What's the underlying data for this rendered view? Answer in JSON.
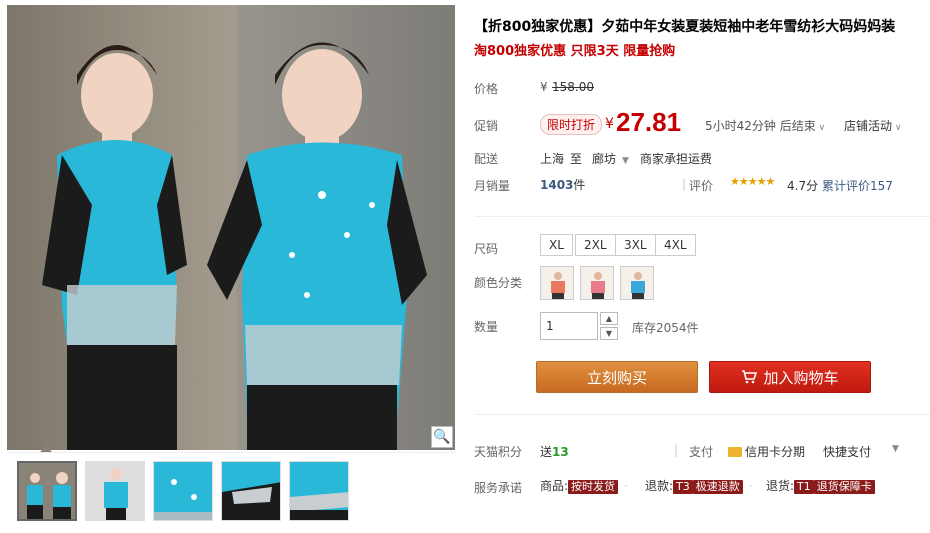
{
  "product": {
    "title": "【折800独家优惠】夕茹中年女装夏装短袖中老年雪纺衫大码妈妈装",
    "promo_line": "淘800独家优惠 只限3天 限量抢购"
  },
  "price": {
    "label": "价格",
    "currency": "¥",
    "original": "158.00",
    "promo_label": "促销",
    "badge": "限时打折",
    "current": "27.81",
    "countdown": "5小时42分钟 后结束",
    "store_activity": "店铺活动"
  },
  "shipping": {
    "label": "配送",
    "from": "上海",
    "to_word": "至",
    "to": "廊坊",
    "fee": "商家承担运费"
  },
  "sales": {
    "label": "月销量",
    "count": "1403",
    "unit": "件",
    "rating_label": "评价",
    "score": "4.7分",
    "stars": 4.7,
    "reviews_text": "累计评价157"
  },
  "size": {
    "label": "尺码",
    "options": [
      "XL",
      "2XL",
      "3XL",
      "4XL"
    ]
  },
  "color": {
    "label": "颜色分类",
    "swatches": [
      {
        "name": "coral-shirt-swatch",
        "color": "#e87860"
      },
      {
        "name": "pink-shirt-swatch",
        "color": "#e87a8a"
      },
      {
        "name": "blue-shirt-swatch",
        "color": "#3aa8d8"
      }
    ]
  },
  "quantity": {
    "label": "数量",
    "value": "1",
    "stock": "库存2054件"
  },
  "actions": {
    "buy_now": "立刻购买",
    "add_to_cart": "加入购物车"
  },
  "points": {
    "label": "天猫积分",
    "send_word": "送",
    "value": "13",
    "pay_label": "支付",
    "credit_card": "信用卡分期",
    "quick_pay": "快捷支付"
  },
  "service": {
    "label": "服务承诺",
    "goods_label": "商品:",
    "goods_tag": "按时发货",
    "refund_label": "退款:",
    "refund_code": "T3",
    "refund_tag": "极速退款",
    "return_label": "退货:",
    "return_code": "T1",
    "return_tag": "退货保障卡"
  },
  "colors": {
    "accent_red": "#c40000",
    "buy_orange": "#d37a2e",
    "cart_red": "#c81e14",
    "shirt_turquoise": "#2ab8d8"
  }
}
